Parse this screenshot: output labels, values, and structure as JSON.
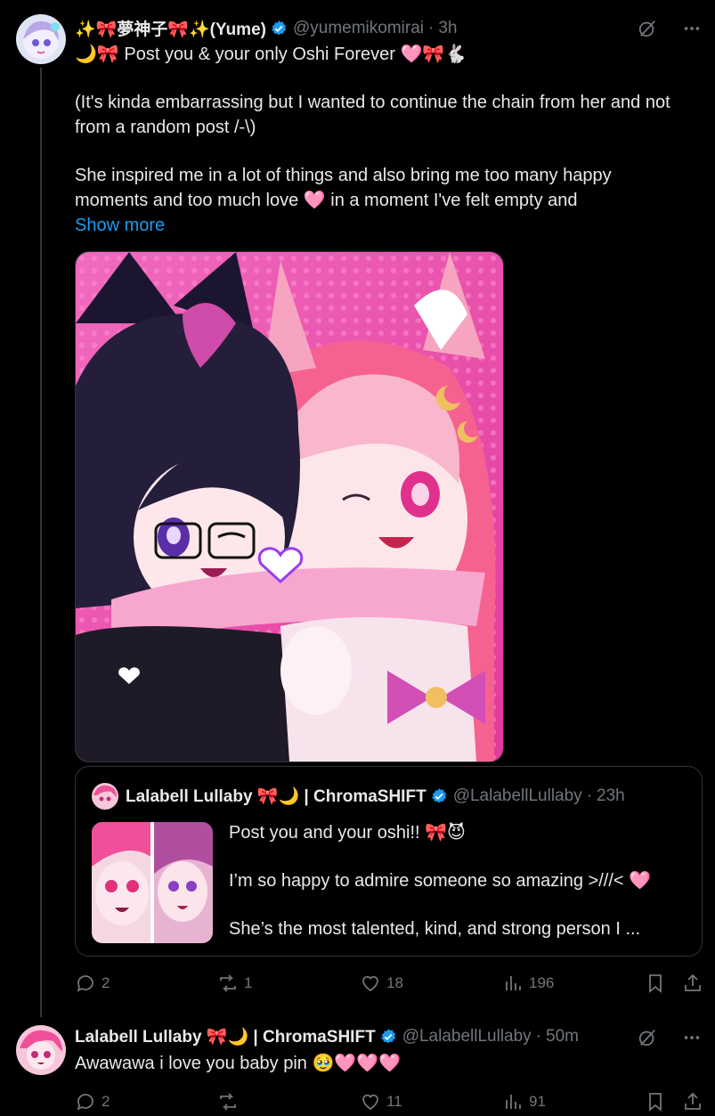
{
  "post": {
    "display_name": "✨🎀夢神子🎀✨(Yume)",
    "handle": "@yumemikomirai",
    "time": "3h",
    "line1": "🌙🎀 Post you & your only Oshi Forever 🩷🎀🐇",
    "line2": "(It's kinda embarrassing but I wanted to continue the chain from her and not from a random post /-\\)",
    "line3": "She inspired me in a lot of things and also bring me too many happy moments and too much love 🩷 in a moment I've felt empty and",
    "show_more": "Show more",
    "replies": "2",
    "reposts": "1",
    "likes": "18",
    "views": "196"
  },
  "quote": {
    "display_name": "Lalabell Lullaby 🎀🌙 | ChromaSHIFT",
    "handle": "@LalabellLullaby",
    "time": "23h",
    "line1": "Post you and your oshi!! 🎀😈",
    "line2": "I’m so happy to admire someone so amazing >///< 🩷",
    "line3": "She’s the most talented, kind, and strong person I ..."
  },
  "reply": {
    "display_name": "Lalabell Lullaby 🎀🌙 | ChromaSHIFT",
    "handle": "@LalabellLullaby",
    "time": "50m",
    "text": "Awawawa i love you baby pin 🥹🩷🩷🩷",
    "replies": "2",
    "reposts": "",
    "likes": "11",
    "views": "91"
  },
  "colors": {
    "background": "#000000",
    "text": "#e7e9ea",
    "muted": "#71767b",
    "link": "#1d9bf0",
    "border": "#2f3336",
    "verified": "#1d9bf0"
  },
  "icons": [
    "verified-badge-icon",
    "grok-icon",
    "more-icon",
    "reply-icon",
    "repost-icon",
    "like-icon",
    "views-icon",
    "bookmark-icon",
    "share-icon"
  ]
}
